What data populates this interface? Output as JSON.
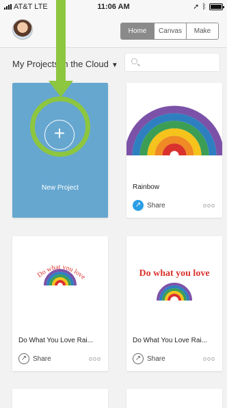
{
  "status": {
    "carrier": "AT&T",
    "network": "LTE",
    "time": "11:06 AM"
  },
  "header": {
    "segments": [
      {
        "label": "Home"
      },
      {
        "label": "Canvas"
      },
      {
        "label": "Make"
      }
    ]
  },
  "toolbar": {
    "title": "My Projects in the Cloud",
    "caret": "▼"
  },
  "new_project": {
    "label": "New Project",
    "plus": "+"
  },
  "cards": [
    {
      "name": "Rainbow",
      "share": "Share",
      "more": "ooo",
      "thumb_text": ""
    },
    {
      "name": "Do What You Love Rai...",
      "share": "Share",
      "more": "ooo",
      "thumb_text": "Do what you love"
    },
    {
      "name": "Do What You Love Rai...",
      "share": "Share",
      "more": "ooo",
      "thumb_text": "Do what you love"
    }
  ],
  "colors": {
    "accent": "#66a7d0",
    "highlight": "#8dc63f"
  }
}
